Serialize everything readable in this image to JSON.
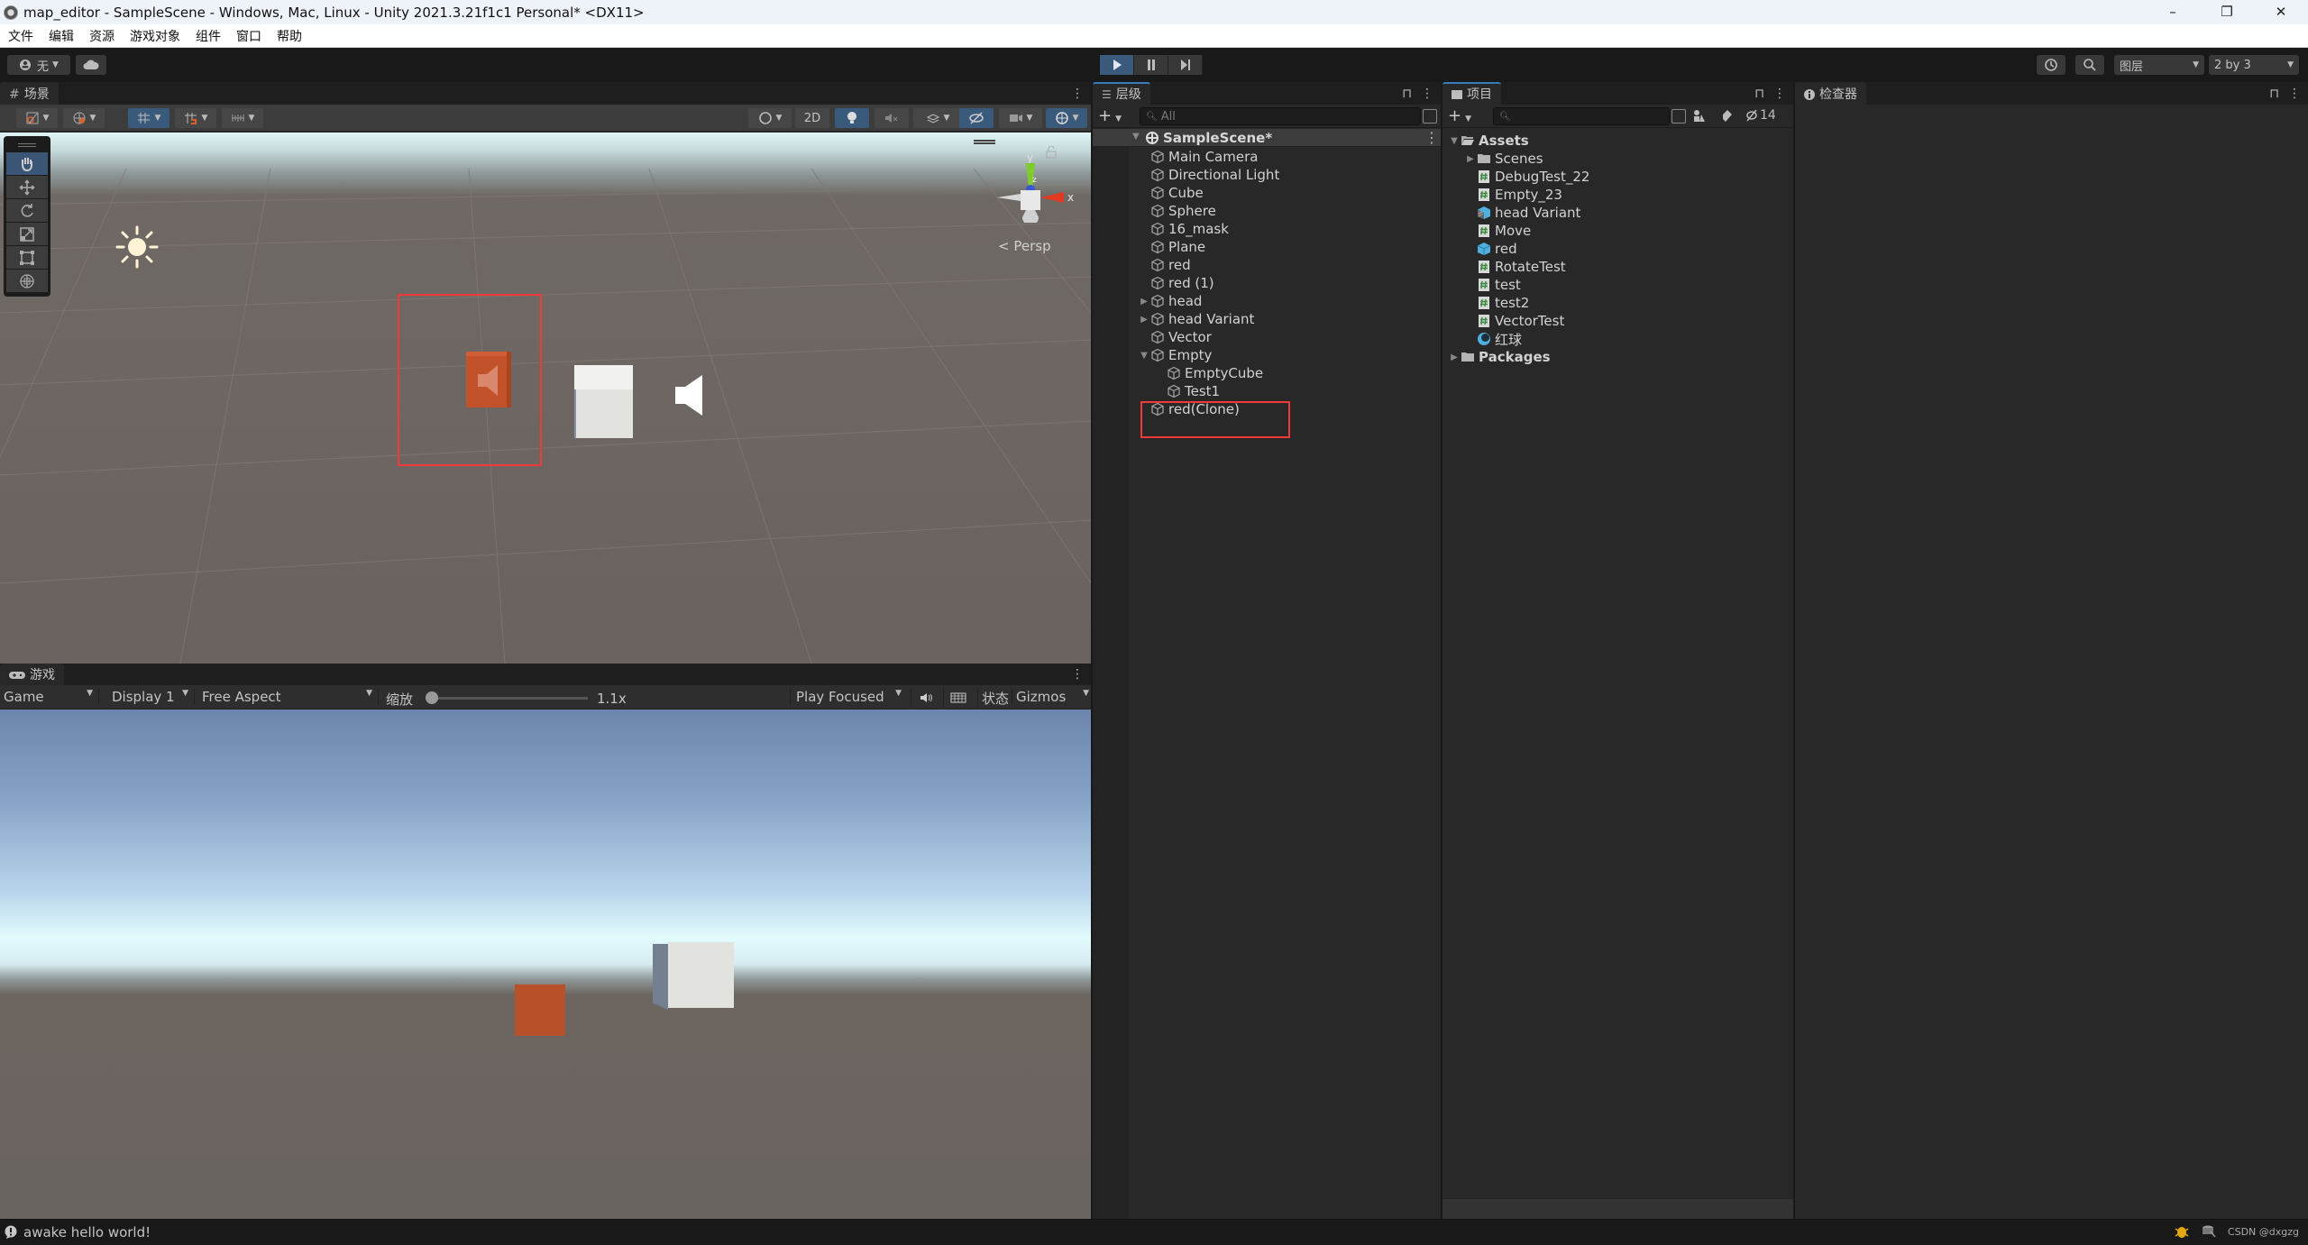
{
  "window": {
    "title": "map_editor - SampleScene - Windows, Mac, Linux - Unity 2021.3.21f1c1 Personal* <DX11>",
    "controls": {
      "minimize": "–",
      "maximize": "❐",
      "close": "✕"
    }
  },
  "menu": [
    "文件",
    "编辑",
    "资源",
    "游戏对象",
    "组件",
    "窗口",
    "帮助"
  ],
  "toolbar": {
    "account_label": "无",
    "cloud_icon": "cloud-icon",
    "play": {
      "play_active": true,
      "pause": "pause",
      "step": "step"
    },
    "history_icon": "history-icon",
    "search_icon": "search-icon",
    "layers_label": "图层",
    "layout_label": "2 by 3"
  },
  "scene": {
    "tab_label": "场景",
    "toolbar": {
      "buttons": [
        "draw-mode",
        "render-globe",
        "grid-snap",
        "snap-increment",
        "ruler"
      ],
      "shading_icon": "shading-icon",
      "mode_2d": "2D",
      "lighting": "lighting-icon",
      "audio": "audio-mute-icon",
      "effects": "effects-icon",
      "hidden": "visibility-icon",
      "camera": "camera-icon",
      "gizmos": "gizmo-icon"
    },
    "tools": [
      "hand",
      "move",
      "rotate",
      "scale",
      "rect",
      "transform"
    ],
    "gizmo": {
      "x": "x",
      "y": "y",
      "z": "z",
      "projection": "Persp"
    }
  },
  "game": {
    "tab_label": "游戏",
    "mode": "Game",
    "display": "Display 1",
    "aspect": "Free Aspect",
    "scale_label": "缩放",
    "scale_value": "1.1x",
    "scale_fraction": 0.02,
    "play_mode": "Play Focused",
    "stats_label": "状态",
    "gizmos_label": "Gizmos"
  },
  "hierarchy": {
    "tab_label": "层级",
    "search_placeholder": "All",
    "scene_name": "SampleScene*",
    "items": [
      {
        "label": "Main Camera",
        "depth": 1,
        "arrow": ""
      },
      {
        "label": "Directional Light",
        "depth": 1,
        "arrow": ""
      },
      {
        "label": "Cube",
        "depth": 1,
        "arrow": ""
      },
      {
        "label": "Sphere",
        "depth": 1,
        "arrow": ""
      },
      {
        "label": "16_mask",
        "depth": 1,
        "arrow": ""
      },
      {
        "label": "Plane",
        "depth": 1,
        "arrow": ""
      },
      {
        "label": "red",
        "depth": 1,
        "arrow": ""
      },
      {
        "label": "red (1)",
        "depth": 1,
        "arrow": ""
      },
      {
        "label": "head",
        "depth": 1,
        "arrow": "▶"
      },
      {
        "label": "head Variant",
        "depth": 1,
        "arrow": "▶"
      },
      {
        "label": "Vector",
        "depth": 1,
        "arrow": ""
      },
      {
        "label": "Empty",
        "depth": 1,
        "arrow": "▼"
      },
      {
        "label": "EmptyCube",
        "depth": 2,
        "arrow": ""
      },
      {
        "label": "Test1",
        "depth": 2,
        "arrow": ""
      },
      {
        "label": "red(Clone)",
        "depth": 1,
        "arrow": ""
      }
    ]
  },
  "project": {
    "tab_label": "项目",
    "search_placeholder": "",
    "hidden_count": "14",
    "items": [
      {
        "label": "Assets",
        "type": "folder-open",
        "depth": 0,
        "arrow": "▼",
        "bold": true
      },
      {
        "label": "Scenes",
        "type": "folder",
        "depth": 1,
        "arrow": "▶"
      },
      {
        "label": "DebugTest_22",
        "type": "script",
        "depth": 1,
        "arrow": ""
      },
      {
        "label": "Empty_23",
        "type": "script",
        "depth": 1,
        "arrow": ""
      },
      {
        "label": "head Variant",
        "type": "prefab-variant",
        "depth": 1,
        "arrow": ""
      },
      {
        "label": "Move",
        "type": "script",
        "depth": 1,
        "arrow": ""
      },
      {
        "label": "red",
        "type": "prefab",
        "depth": 1,
        "arrow": ""
      },
      {
        "label": "RotateTest",
        "type": "script",
        "depth": 1,
        "arrow": ""
      },
      {
        "label": "test",
        "type": "script",
        "depth": 1,
        "arrow": ""
      },
      {
        "label": "test2",
        "type": "script",
        "depth": 1,
        "arrow": ""
      },
      {
        "label": "VectorTest",
        "type": "script",
        "depth": 1,
        "arrow": ""
      },
      {
        "label": "红球",
        "type": "material",
        "depth": 1,
        "arrow": ""
      },
      {
        "label": "Packages",
        "type": "folder",
        "depth": 0,
        "arrow": "▶",
        "bold": true
      }
    ]
  },
  "inspector": {
    "tab_label": "检查器"
  },
  "status": {
    "message": "awake hello world!",
    "watermark": "CSDN @dxgzg"
  },
  "colors": {
    "accent_blue": "#3a5a7c",
    "highlight_red": "#f03a3a",
    "red_cube": "#c2522a",
    "script_green": "#4a8c4a",
    "prefab_blue": "#4fb0e0"
  }
}
